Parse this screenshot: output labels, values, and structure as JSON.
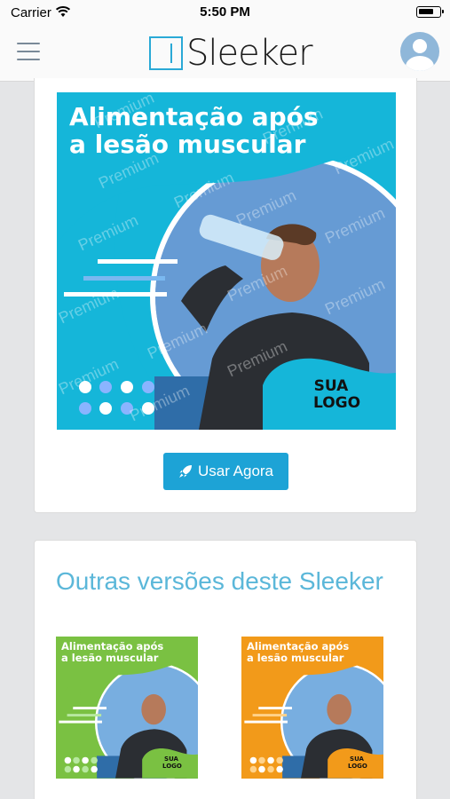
{
  "status_bar": {
    "carrier": "Carrier",
    "time": "5:50 PM"
  },
  "navbar": {
    "logo_text": "Sleeker",
    "menu_icon": "hamburger-icon",
    "avatar_icon": "user-avatar-icon"
  },
  "template": {
    "headline_line1": "Alimentação após",
    "headline_line2": "a lesão muscular",
    "logo_line1": "SUA",
    "logo_line2": "LOGO",
    "watermark": "Premium",
    "background_color": "#15b6d9"
  },
  "primary_action": {
    "label": "Usar Agora",
    "icon": "rocket-icon"
  },
  "other_versions": {
    "title": "Outras versões deste Sleeker",
    "items": [
      {
        "headline_line1": "Alimentação após",
        "headline_line2": "a lesão muscular",
        "logo_line1": "SUA",
        "logo_line2": "LOGO",
        "color": "#7ac142"
      },
      {
        "headline_line1": "Alimentação após",
        "headline_line2": "a lesão muscular",
        "logo_line1": "SUA",
        "logo_line2": "LOGO",
        "color": "#f29a1a"
      }
    ]
  }
}
